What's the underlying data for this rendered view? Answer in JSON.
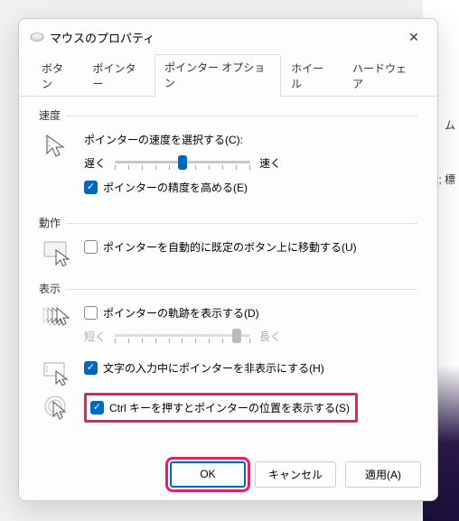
{
  "backdrop": {
    "text1": "ム",
    "text2": "; 標"
  },
  "dialog": {
    "title": "マウスのプロパティ",
    "tabs": [
      "ボタン",
      "ポインター",
      "ポインター オプション",
      "ホイール",
      "ハードウェア"
    ],
    "active_tab": "ポインター オプション"
  },
  "speed": {
    "group_label": "速度",
    "label": "ポインターの速度を選択する(C):",
    "slow": "遅く",
    "fast": "速く",
    "slider_value": 5,
    "slider_max": 10,
    "precision_checked": true,
    "precision_label": "ポインターの精度を高める(E)"
  },
  "motion": {
    "group_label": "動作",
    "snap_checked": false,
    "snap_label": "ポインターを自動的に既定のボタン上に移動する(U)"
  },
  "display": {
    "group_label": "表示",
    "trails_checked": false,
    "trails_label": "ポインターの軌跡を表示する(D)",
    "trails_short": "短く",
    "trails_long": "長く",
    "trails_slider_value": 9,
    "trails_slider_max": 10,
    "hide_typing_checked": true,
    "hide_typing_label": "文字の入力中にポインターを非表示にする(H)",
    "ctrl_checked": true,
    "ctrl_label": "Ctrl キーを押すとポインターの位置を表示する(S)"
  },
  "buttons": {
    "ok": "OK",
    "cancel": "キャンセル",
    "apply": "適用(A)"
  }
}
